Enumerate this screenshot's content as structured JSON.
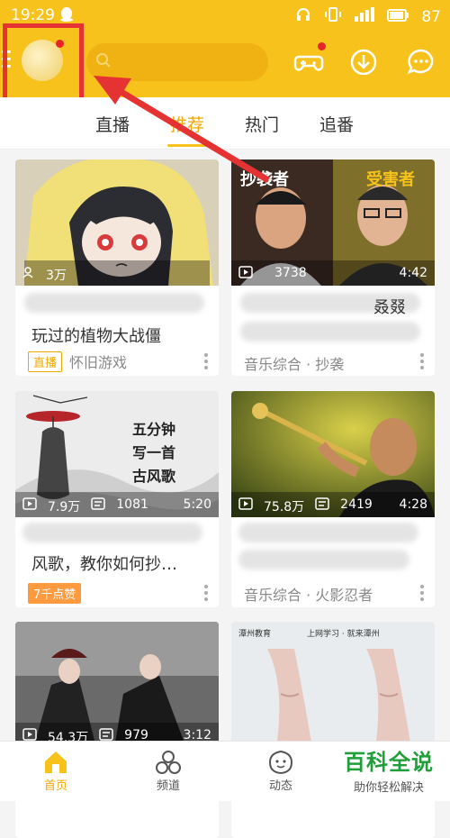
{
  "status_bar": {
    "time": "19:29",
    "battery": "87"
  },
  "header": {
    "search_placeholder": ""
  },
  "tabs": [
    {
      "label": "直播"
    },
    {
      "label": "推荐"
    },
    {
      "label": "热门"
    },
    {
      "label": "追番"
    }
  ],
  "cards": [
    {
      "stats": [
        "3万",
        ""
      ],
      "duration": "",
      "title": "玩过的植物大战僵",
      "badge": "直播",
      "channel": "怀旧游戏"
    },
    {
      "stats": [
        "",
        "3738"
      ],
      "duration": "4:42",
      "title": "",
      "badge": "",
      "channel": "音乐综合 · 抄袭",
      "overlay": [
        "抄袭者",
        "受害者"
      ],
      "title_fragment": "叒叕"
    },
    {
      "stats": [
        "7.9万",
        "1081"
      ],
      "duration": "5:20",
      "title": "风歌，教你如何抄…",
      "badge": "7千点赞",
      "channel": "",
      "overlay": [
        "五分钟",
        "写一首",
        "古风歌"
      ]
    },
    {
      "stats": [
        "75.8万",
        "2419"
      ],
      "duration": "4:28",
      "title": "",
      "badge": "",
      "channel": "音乐综合 · 火影忍者"
    },
    {
      "stats": [
        "54.3万",
        "979"
      ],
      "duration": "3:12",
      "title": "",
      "badge": "",
      "channel": ""
    },
    {
      "stats": [
        "",
        ""
      ],
      "duration": "",
      "title": "",
      "badge": "",
      "channel": "",
      "overlay": [
        "潭州教育",
        "上网学习 · 就来潭州"
      ]
    }
  ],
  "bottom_nav": [
    {
      "label": "首页"
    },
    {
      "label": "频道"
    },
    {
      "label": "动态"
    }
  ],
  "watermark": {
    "title": "百科全说",
    "subtitle": "助你轻松解决"
  },
  "colors": {
    "accent": "#f6c21b",
    "highlight": "#e53232",
    "active_text": "#f0a800"
  }
}
